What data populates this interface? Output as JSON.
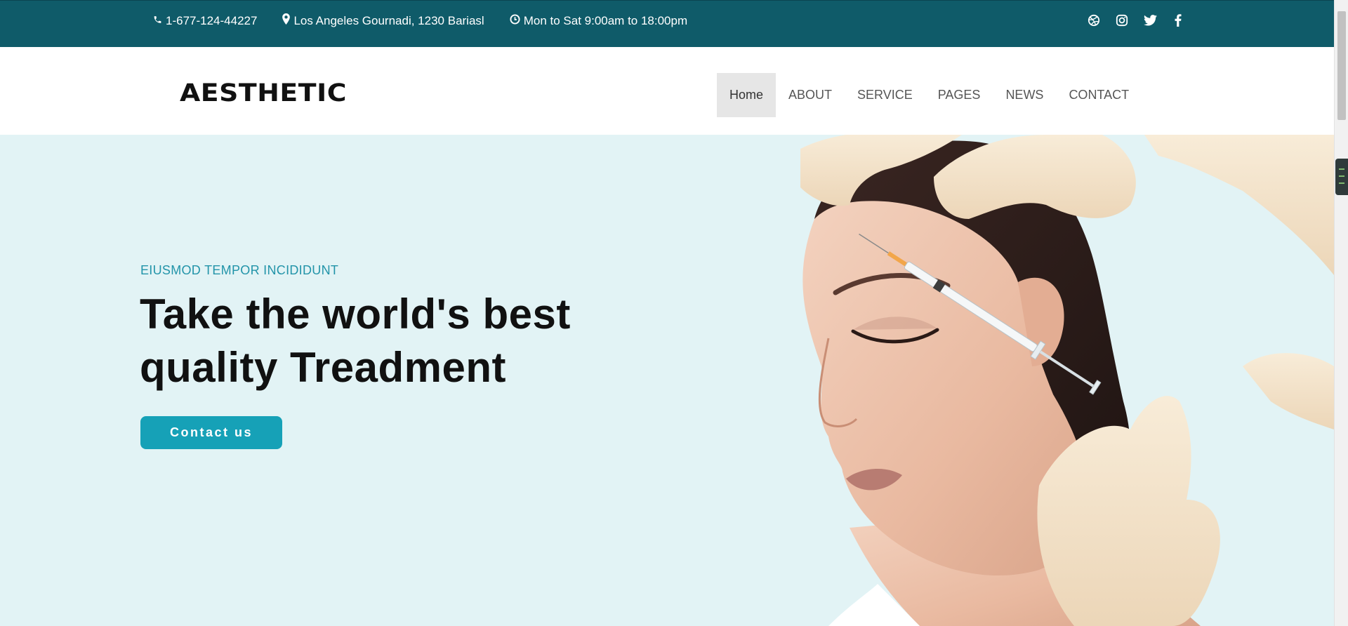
{
  "topbar": {
    "phone": "1-677-124-44227",
    "address": "Los Angeles Gournadi, 1230 Bariasl",
    "hours": "Mon to Sat 9:00am to 18:00pm",
    "icons": [
      "phone-icon",
      "map-marker-icon",
      "clock-icon"
    ],
    "socials": [
      "dribbble-icon",
      "instagram-icon",
      "twitter-icon",
      "facebook-icon"
    ]
  },
  "header": {
    "logo": "AESTHETIC",
    "nav": [
      {
        "label": "Home",
        "active": true
      },
      {
        "label": "ABOUT",
        "active": false
      },
      {
        "label": "SERVICE",
        "active": false
      },
      {
        "label": "PAGES",
        "active": false
      },
      {
        "label": "NEWS",
        "active": false
      },
      {
        "label": "CONTACT",
        "active": false
      }
    ]
  },
  "hero": {
    "subtitle": "EIUSMOD TEMPOR INCIDIDUNT",
    "title_line1": "Take the world's best",
    "title_line2": "quality Treadment",
    "cta": "Contact us"
  },
  "colors": {
    "topbar": "#0f5b69",
    "accent": "#16a1b7",
    "hero_bg": "#e2f3f5",
    "subtitle": "#2294a9"
  }
}
